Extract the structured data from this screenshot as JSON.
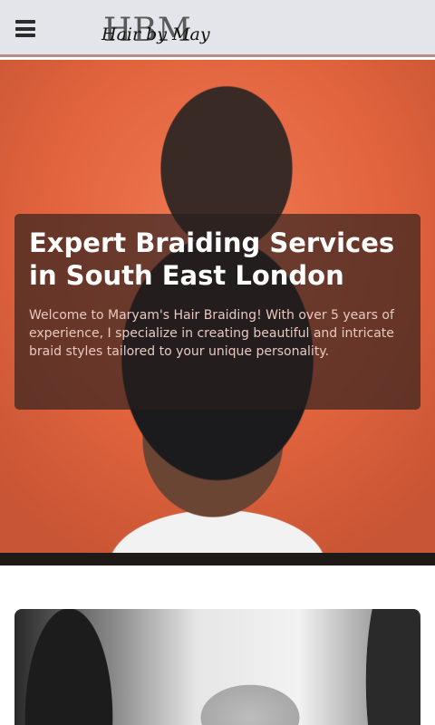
{
  "header": {
    "menu_icon": "hamburger-menu-icon",
    "logo_main": "HBM",
    "logo_script": "Hair by May"
  },
  "hero": {
    "title": "Expert Braiding Services in South East London",
    "text": "Welcome to Maryam's Hair Braiding! With over 5 years of experience, I specialize in creating beautiful and intricate braid styles tailored to your unique personality."
  },
  "colors": {
    "header_bg": "#e4e5ea",
    "hero_bg": "#e2643d",
    "card_bg": "rgba(40,30,30,0.66)"
  }
}
